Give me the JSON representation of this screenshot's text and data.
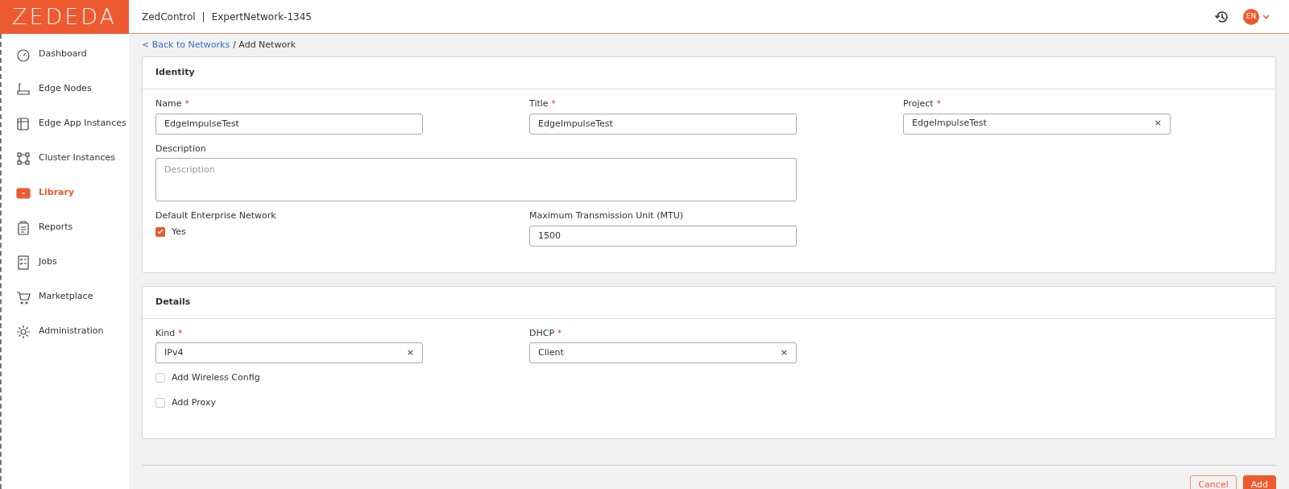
{
  "logo": "ZEDEDA",
  "header": {
    "app": "ZedControl",
    "separator": "|",
    "context": "ExpertNetwork-1345",
    "language": "EN"
  },
  "sidebar": {
    "items": [
      {
        "label": "Dashboard",
        "selected": false
      },
      {
        "label": "Edge Nodes",
        "selected": false
      },
      {
        "label": "Edge App Instances",
        "selected": false
      },
      {
        "label": "Cluster Instances",
        "selected": false
      },
      {
        "label": "Library",
        "selected": true
      },
      {
        "label": "Reports",
        "selected": false
      },
      {
        "label": "Jobs",
        "selected": false
      },
      {
        "label": "Marketplace",
        "selected": false
      },
      {
        "label": "Administration",
        "selected": false
      }
    ]
  },
  "breadcrumb": {
    "link": "< Back to Networks",
    "current": "/ Add Network"
  },
  "sections": [
    {
      "title": "Identity",
      "rows": [
        [
          {
            "kind": "text",
            "label": "Name",
            "required_mark": "*",
            "value": "EdgeImpulseTest"
          },
          {
            "kind": "text",
            "label": "Title",
            "required_mark": "*",
            "value": "EdgeImpulseTest"
          },
          {
            "kind": "select",
            "label": "Project",
            "required_mark": "*",
            "value": "EdgeImpulseTest",
            "clear": "×"
          }
        ],
        [
          {
            "kind": "textarea",
            "label": "Description",
            "placeholder": "Description"
          }
        ],
        [
          {
            "kind": "checkbox",
            "label": "Default Enterprise Network",
            "option": "Yes",
            "checked": true
          },
          {
            "kind": "text",
            "label": "Maximum Transmission Unit (MTU)",
            "value": "1500"
          }
        ]
      ]
    },
    {
      "title": "Details",
      "rows": [
        [
          {
            "kind": "select",
            "label": "Kind",
            "required_mark": "*",
            "value": "IPv4",
            "clear": "×"
          },
          {
            "kind": "select",
            "label": "DHCP",
            "required_mark": "*",
            "value": "Client",
            "clear": "×"
          }
        ],
        [
          {
            "kind": "check",
            "option": "Add Wireless Config",
            "checked": false
          }
        ],
        [
          {
            "kind": "check",
            "option": "Add Proxy",
            "checked": false
          }
        ]
      ]
    }
  ],
  "buttons": [
    {
      "label": "Cancel",
      "kind": "outline"
    },
    {
      "label": "Add",
      "kind": "primary"
    }
  ]
}
